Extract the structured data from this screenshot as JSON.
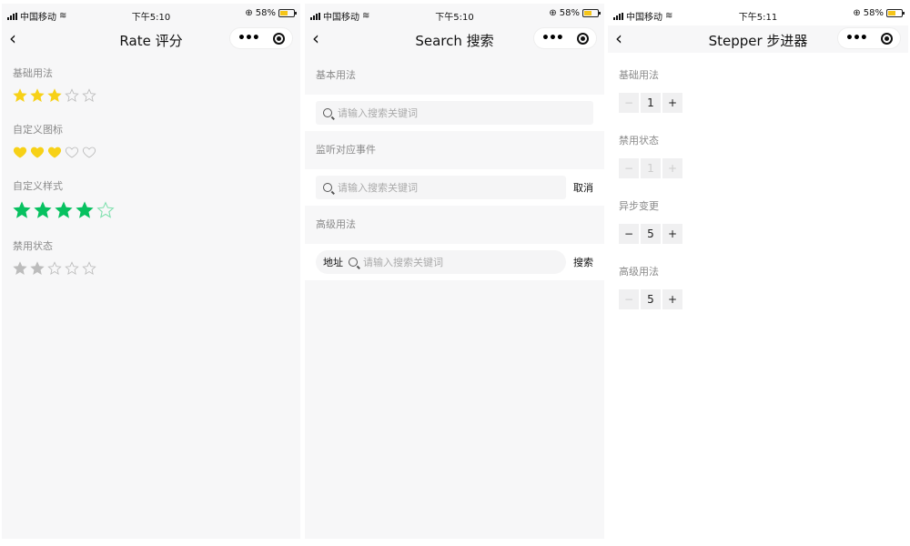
{
  "status": {
    "carrier": "中国移动",
    "battery": "58%",
    "battery_level": 0.58
  },
  "screens": [
    {
      "time": "下午5:10",
      "title": "Rate 评分"
    },
    {
      "time": "下午5:10",
      "title": "Search 搜索"
    },
    {
      "time": "下午5:11",
      "title": "Stepper 步进器"
    }
  ],
  "rate": {
    "sections": [
      {
        "label": "基础用法",
        "value": 3,
        "max": 5,
        "color": "#f7d117",
        "icon": "star-icon"
      },
      {
        "label": "自定义图标",
        "value": 3,
        "max": 5,
        "color": "#f7d117",
        "icon": "heart-icon"
      },
      {
        "label": "自定义样式",
        "value": 4,
        "max": 5,
        "color": "#07c160",
        "icon": "star-icon"
      },
      {
        "label": "禁用状态",
        "value": 2,
        "max": 5,
        "color": "#bcbcbc",
        "icon": "star-icon"
      }
    ]
  },
  "search": {
    "sections": [
      {
        "label": "基本用法",
        "placeholder": "请输入搜索关键词",
        "action": ""
      },
      {
        "label": "监听对应事件",
        "placeholder": "请输入搜索关键词",
        "action": "取消"
      },
      {
        "label": "高级用法",
        "placeholder": "请输入搜索关键词",
        "action": "搜索",
        "prefix": "地址"
      }
    ]
  },
  "stepper": {
    "sections": [
      {
        "label": "基础用法",
        "value": "1",
        "minus": "−",
        "plus": "+"
      },
      {
        "label": "禁用状态",
        "value": "1",
        "minus": "−",
        "plus": "+"
      },
      {
        "label": "异步变更",
        "value": "5",
        "minus": "−",
        "plus": "+"
      },
      {
        "label": "高级用法",
        "value": "5",
        "minus": "−",
        "plus": "+"
      }
    ]
  }
}
